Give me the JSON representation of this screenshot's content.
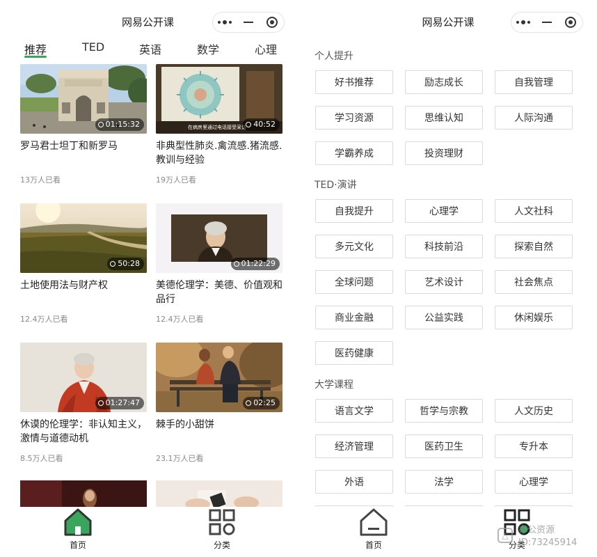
{
  "header": {
    "title": "网易公开课"
  },
  "tabs": [
    {
      "label": "推荐",
      "active": true
    },
    {
      "label": "TED",
      "active": false
    },
    {
      "label": "英语",
      "active": false
    },
    {
      "label": "数学",
      "active": false
    },
    {
      "label": "心理",
      "active": false
    }
  ],
  "videos": [
    {
      "title": "罗马君士坦丁和新罗马",
      "duration": "01:15:32",
      "views": "13万人已看"
    },
    {
      "title": "非典型性肺炎.禽流感.猪流感.教训与经验",
      "duration": "40:52",
      "views": "19万人已看"
    },
    {
      "title": "土地使用法与财产权",
      "duration": "50:28",
      "views": "12.4万人已看"
    },
    {
      "title": "美德伦理学：美德、价值观和品行",
      "duration": "01:22:29",
      "views": "12.4万人已看"
    },
    {
      "title": "休谟的伦理学：非认知主义，激情与道德动机",
      "duration": "01:27:47",
      "views": "8.5万人已看"
    },
    {
      "title": "棘手的小甜饼",
      "duration": "02:25",
      "views": "23.1万人已看"
    }
  ],
  "video_subtitle": "在病房里通过电话接受采访",
  "bottom_nav": {
    "home_label": "首页",
    "category_label": "分类"
  },
  "categories": [
    {
      "title": "个人提升",
      "items": [
        "好书推荐",
        "励志成长",
        "自我管理",
        "学习资源",
        "思维认知",
        "人际沟通",
        "学霸养成",
        "投资理财"
      ]
    },
    {
      "title": "TED·演讲",
      "items": [
        "自我提升",
        "心理学",
        "人文社科",
        "多元文化",
        "科技前沿",
        "探索自然",
        "全球问题",
        "艺术设计",
        "社会焦点",
        "商业金融",
        "公益实践",
        "休闲娱乐",
        "医药健康"
      ]
    },
    {
      "title": "大学课程",
      "items": [
        "语言文学",
        "哲学与宗教",
        "人文历史",
        "经济管理",
        "医药卫生",
        "专升本",
        "外语",
        "法学",
        "心理学"
      ]
    }
  ],
  "watermark": {
    "line1": "办公资源",
    "line2": "ID:73245914"
  },
  "colors": {
    "accent": "#3aa55d",
    "text": "#222222",
    "muted": "#888888",
    "chip_border": "#d9d9d9"
  }
}
